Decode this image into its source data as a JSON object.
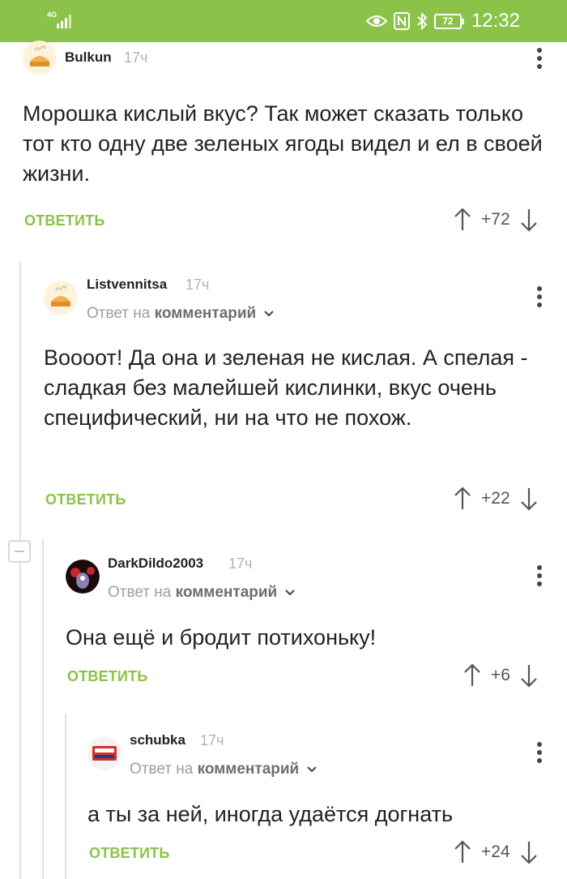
{
  "status_bar": {
    "network": "4G",
    "battery": "72",
    "time": "12:32"
  },
  "labels": {
    "reply_prefix": "Ответ на",
    "reply_target": "комментарий",
    "answer": "ОТВЕТИТЬ"
  },
  "comments": [
    {
      "author": "Bulkun",
      "time": "17ч",
      "text": "Морошка кислый вкус? Так может сказать только тот кто одну две зеленых ягоды видел и ел в своей жизни.",
      "rating": "+72",
      "avatar_icon": "pie-avatar"
    },
    {
      "author": "Listvennitsa",
      "time": "17ч",
      "text": "Воооот! Да она и зеленая не кислая. А спелая - сладкая без малейшей кислинки, вкус очень специфический, ни на что не похож.",
      "rating": "+22",
      "avatar_icon": "pie-avatar"
    },
    {
      "author": "DarkDildo2003",
      "time": "17ч",
      "text": "Она ещё и бродит потихоньку!",
      "rating": "+6",
      "avatar_icon": "monster-avatar"
    },
    {
      "author": "schubka",
      "time": "17ч",
      "text": "а ты за ней, иногда удаётся догнать",
      "rating": "+24",
      "avatar_icon": "box-avatar"
    }
  ],
  "colors": {
    "accent": "#8bc34a",
    "meta": "#9e9e9e",
    "thread": "#e1e1e1"
  }
}
